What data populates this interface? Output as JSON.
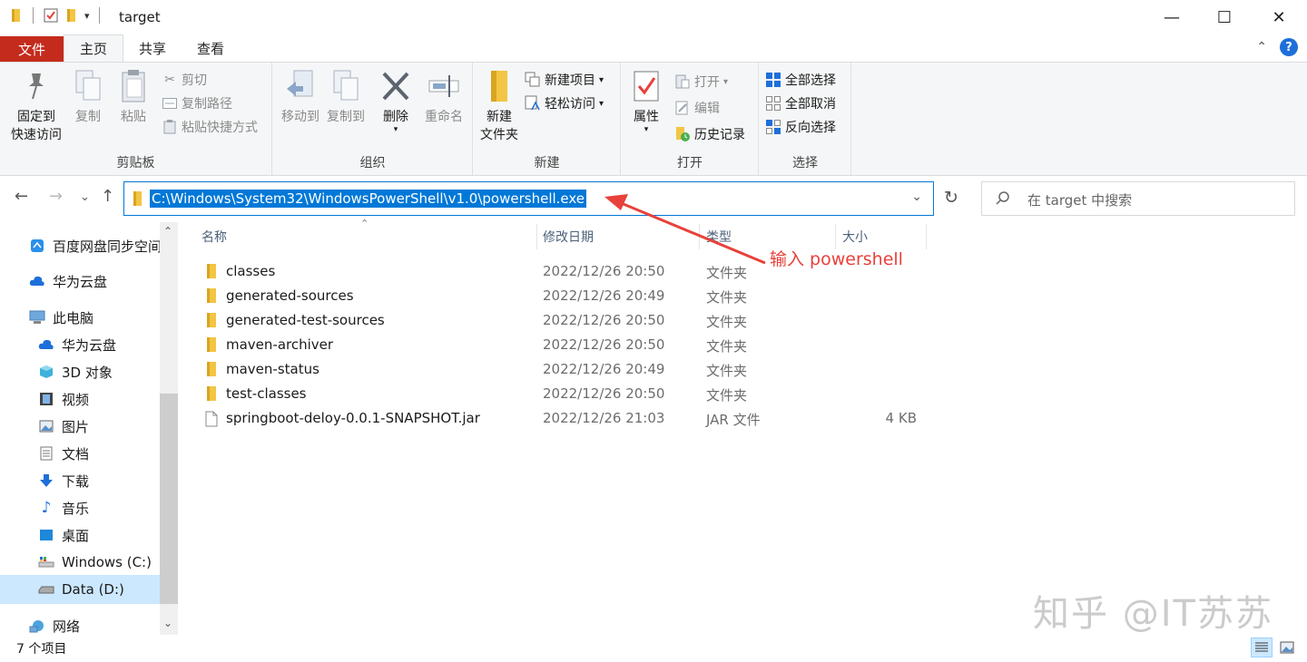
{
  "window": {
    "title": "target",
    "minimize_glyph": "—",
    "maximize_glyph": "☐",
    "close_glyph": "✕"
  },
  "tabs": {
    "file": "文件",
    "home": "主页",
    "share": "共享",
    "view": "查看"
  },
  "ribbon": {
    "clipboard": {
      "label": "剪贴板",
      "pin_l1": "固定到",
      "pin_l2": "快速访问",
      "copy": "复制",
      "paste": "粘贴",
      "cut": "剪切",
      "copy_path": "复制路径",
      "paste_shortcut": "粘贴快捷方式"
    },
    "organize": {
      "label": "组织",
      "move_to": "移动到",
      "copy_to": "复制到",
      "delete": "删除",
      "rename": "重命名"
    },
    "new": {
      "label": "新建",
      "new_folder_l1": "新建",
      "new_folder_l2": "文件夹",
      "new_item": "新建项目",
      "easy_access": "轻松访问"
    },
    "open": {
      "label": "打开",
      "properties": "属性",
      "open": "打开",
      "edit": "编辑",
      "history": "历史记录"
    },
    "select": {
      "label": "选择",
      "select_all": "全部选择",
      "select_none": "全部取消",
      "invert": "反向选择"
    }
  },
  "address": {
    "path": "C:\\Windows\\System32\\WindowsPowerShell\\v1.0\\powershell.exe"
  },
  "search": {
    "placeholder": "在 target 中搜索"
  },
  "nav": [
    {
      "label": "百度网盘同步空间",
      "icon": "baidu-cloud-icon"
    },
    {
      "label": "华为云盘",
      "icon": "cloud-icon"
    },
    {
      "label": "此电脑",
      "icon": "computer-icon"
    },
    {
      "label": "华为云盘",
      "icon": "cloud-icon"
    },
    {
      "label": "3D 对象",
      "icon": "cube-icon"
    },
    {
      "label": "视频",
      "icon": "video-icon"
    },
    {
      "label": "图片",
      "icon": "picture-icon"
    },
    {
      "label": "文档",
      "icon": "document-icon"
    },
    {
      "label": "下载",
      "icon": "download-icon"
    },
    {
      "label": "音乐",
      "icon": "music-icon"
    },
    {
      "label": "桌面",
      "icon": "desktop-icon"
    },
    {
      "label": "Windows (C:)",
      "icon": "drive-icon"
    },
    {
      "label": "Data (D:)",
      "icon": "drive-icon"
    },
    {
      "label": "网络",
      "icon": "network-icon"
    }
  ],
  "columns": {
    "name": "名称",
    "date": "修改日期",
    "type": "类型",
    "size": "大小"
  },
  "files": [
    {
      "name": "classes",
      "date": "2022/12/26 20:50",
      "type": "文件夹",
      "size": ""
    },
    {
      "name": "generated-sources",
      "date": "2022/12/26 20:49",
      "type": "文件夹",
      "size": ""
    },
    {
      "name": "generated-test-sources",
      "date": "2022/12/26 20:50",
      "type": "文件夹",
      "size": ""
    },
    {
      "name": "maven-archiver",
      "date": "2022/12/26 20:50",
      "type": "文件夹",
      "size": ""
    },
    {
      "name": "maven-status",
      "date": "2022/12/26 20:49",
      "type": "文件夹",
      "size": ""
    },
    {
      "name": "test-classes",
      "date": "2022/12/26 20:50",
      "type": "文件夹",
      "size": ""
    },
    {
      "name": "springboot-deloy-0.0.1-SNAPSHOT.jar",
      "date": "2022/12/26 21:03",
      "type": "JAR 文件",
      "size": "4 KB"
    }
  ],
  "annotation": "输入 powershell",
  "status": "7 个项目",
  "watermark": "知乎 @IT苏苏",
  "colors": {
    "accent": "#0078d7",
    "file_tab": "#c42b1c",
    "annotation": "#e8413b",
    "folder": "#f3c544"
  }
}
